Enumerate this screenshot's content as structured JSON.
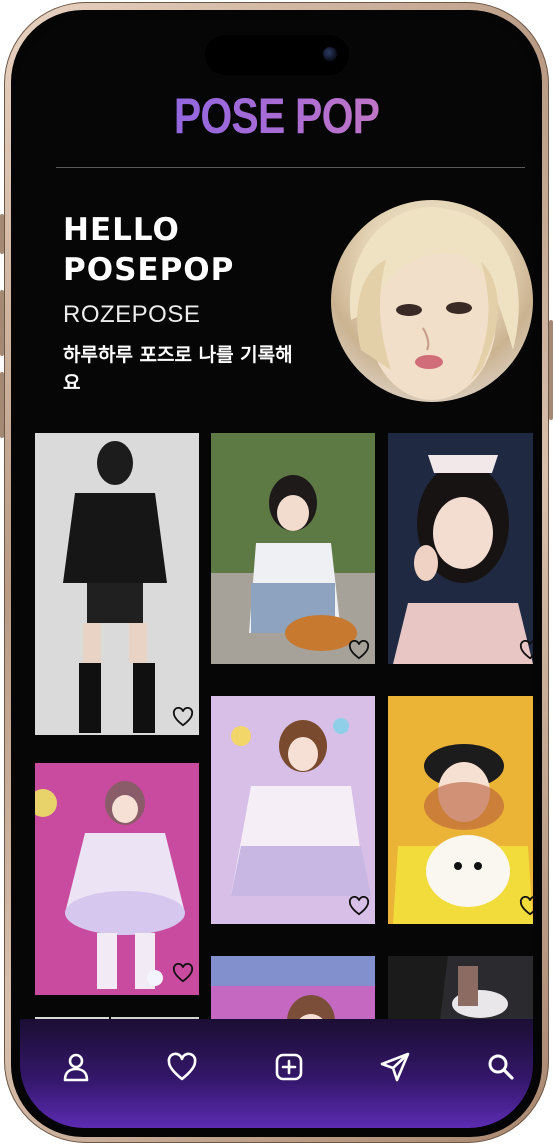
{
  "app": {
    "brand": "POSE POP"
  },
  "profile": {
    "greeting": "HELLO\nPOSEPOP",
    "greeting_line1": "HELLO",
    "greeting_line2": "POSEPOP",
    "handle": "ROZEPOSE",
    "tagline": "하루하루 포즈로 나를 기록해요"
  },
  "colors": {
    "background": "#060606",
    "brand_gradient_start": "#7c63e6",
    "brand_gradient_end": "#d97fb6",
    "tabbar_gradient_end": "#5c2bb3"
  },
  "feed": {
    "posts": [
      {
        "id": "post-1",
        "icon": "heart-outline-icon"
      },
      {
        "id": "post-2",
        "icon": "heart-outline-icon"
      },
      {
        "id": "post-3",
        "icon": "heart-outline-icon"
      },
      {
        "id": "post-4",
        "icon": "heart-outline-icon"
      },
      {
        "id": "post-5",
        "icon": "heart-outline-icon"
      },
      {
        "id": "post-6",
        "icon": "heart-outline-icon"
      },
      {
        "id": "post-7",
        "icon": "heart-outline-icon"
      },
      {
        "id": "post-8",
        "icon": "heart-outline-icon"
      }
    ]
  },
  "tabbar": {
    "items": [
      {
        "icon": "profile-icon"
      },
      {
        "icon": "heart-icon"
      },
      {
        "icon": "add-icon"
      },
      {
        "icon": "send-icon"
      },
      {
        "icon": "search-icon"
      }
    ]
  }
}
